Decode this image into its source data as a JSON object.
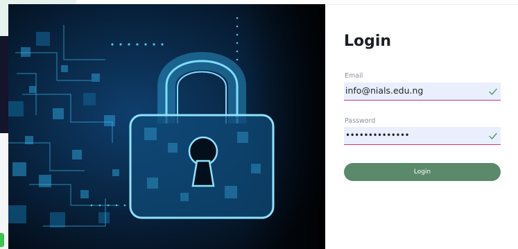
{
  "login": {
    "title": "Login",
    "email_label": "Email",
    "email_value": "info@nials.edu.ng",
    "password_label": "Password",
    "password_value": "••••••••••••••",
    "submit_label": "Login"
  },
  "icons": {
    "hero": "padlock-circuit-illustration",
    "field_valid": "check-icon"
  },
  "colors": {
    "button": "#5b8a6b",
    "field_background": "#e9effd",
    "field_underline": "#c93c6a",
    "check": "#4c9a6a"
  }
}
